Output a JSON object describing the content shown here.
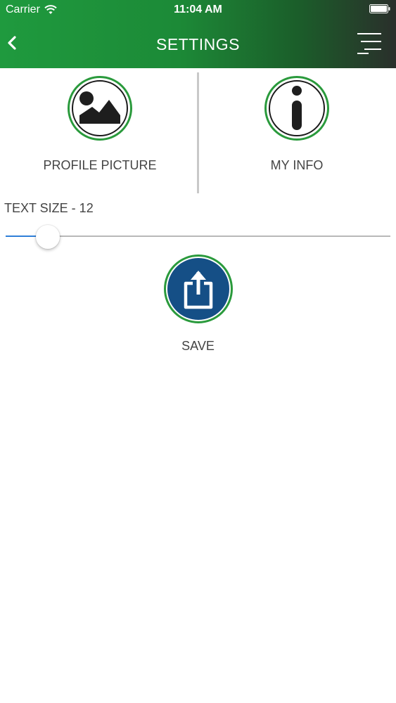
{
  "status_bar": {
    "carrier": "Carrier",
    "time": "11:04 AM"
  },
  "nav": {
    "title": "SETTINGS",
    "back_icon": "chevron-left-icon",
    "menu_icon": "hamburger-menu-icon"
  },
  "options": [
    {
      "label": "PROFILE PICTURE",
      "icon": "image-icon"
    },
    {
      "label": "MY INFO",
      "icon": "info-icon"
    }
  ],
  "text_size": {
    "label": "TEXT SIZE - 12",
    "value_fraction": 0.11
  },
  "save": {
    "label": "SAVE",
    "icon": "share-upload-icon"
  },
  "colors": {
    "header_green": "#1f9a3e",
    "ring_green": "#2a9a3c",
    "save_blue": "#154f86",
    "slider_blue": "#2f7fd8"
  }
}
